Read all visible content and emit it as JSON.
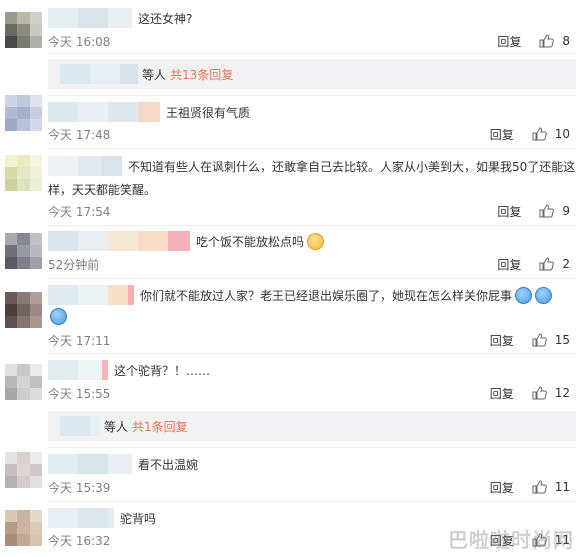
{
  "comments": [
    {
      "text": "这还女神?",
      "time": "今天 16:08",
      "reply": "回复",
      "likes": "8"
    },
    {
      "text": "王祖贤很有气质",
      "time": "今天 17:48",
      "reply": "回复",
      "likes": "10"
    },
    {
      "text": "不知道有些人在讽刺什么，还敢拿自己去比较。人家从小美到大，如果我50了还能这",
      "text2": "样，天天都能笑醒。",
      "time": "今天 17:54",
      "reply": "回复",
      "likes": "9"
    },
    {
      "text": "吃个饭不能放松点吗",
      "time": "52分钟前",
      "reply": "回复",
      "likes": "2"
    },
    {
      "text": "你们就不能放过人家？老王已经退出娱乐圈了，她现在怎么样关你屁事",
      "time": "今天 17:11",
      "reply": "回复",
      "likes": "15"
    },
    {
      "text": "这个驼背？！……",
      "time": "今天 15:55",
      "reply": "回复",
      "likes": "12"
    },
    {
      "text": "看不出温婉",
      "time": "今天 15:39",
      "reply": "回复",
      "likes": "11"
    },
    {
      "text": "驼背吗",
      "time": "今天 16:32",
      "reply": "回复",
      "likes": "11"
    }
  ],
  "sub_replies": [
    {
      "who": "等人",
      "count": "共13条回复"
    },
    {
      "who": "等人",
      "count": "共1条回复"
    }
  ],
  "icons": {
    "like": "thumbs-up-icon",
    "emoji_laugh": "laughing-emoji-icon",
    "emoji_face": "face-emoji-icon"
  },
  "watermark": "巴啦啦时尚网"
}
